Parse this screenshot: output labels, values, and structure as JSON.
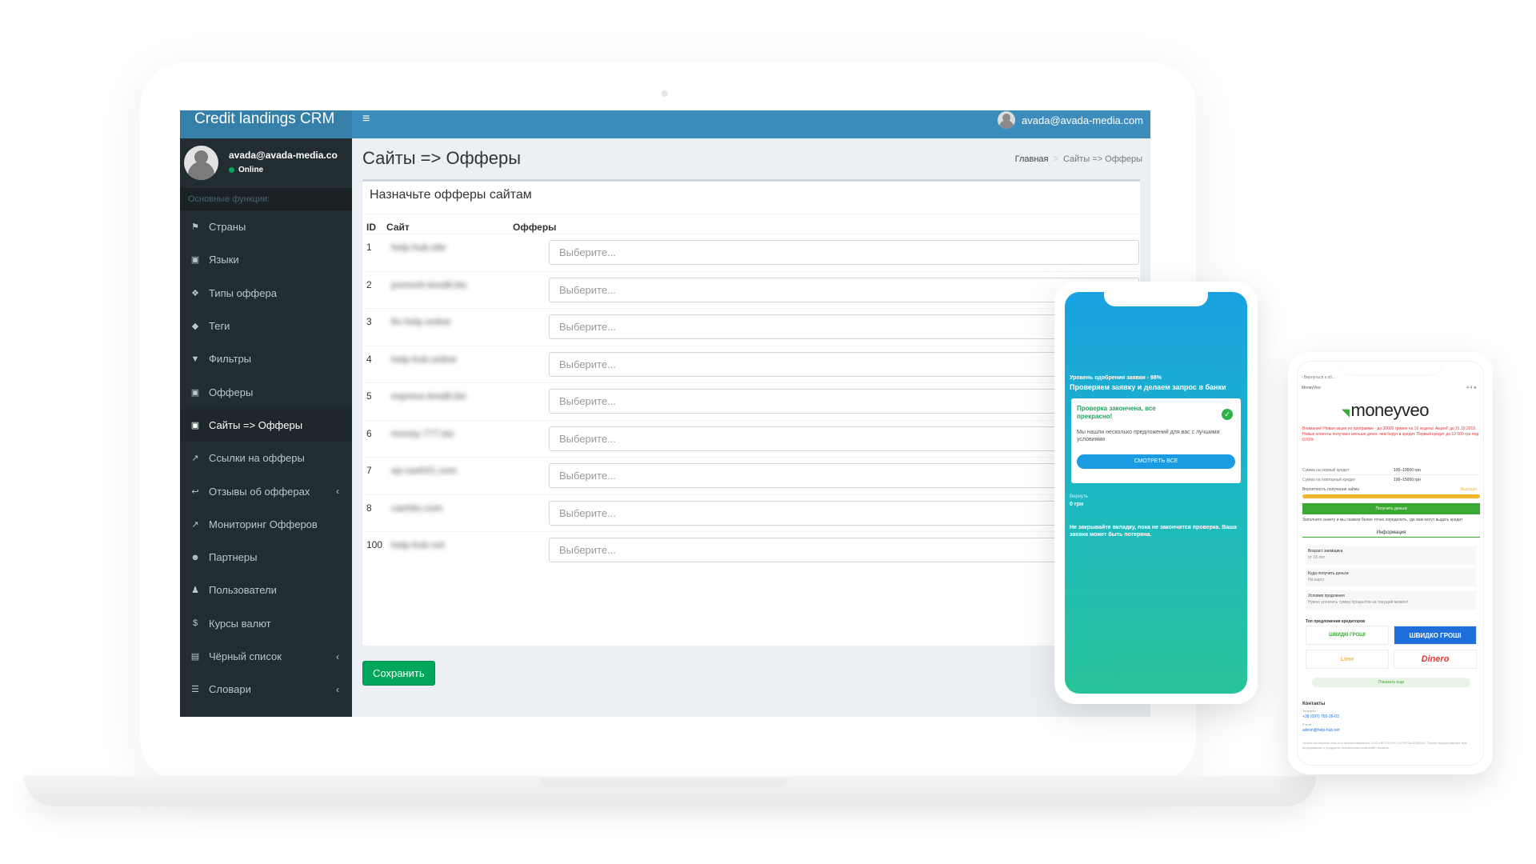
{
  "crm": {
    "brand": "Credit landings CRM",
    "menu_toggle_glyph": "≡",
    "top_user_email": "avada@avada-media.com",
    "sidebar_user_email": "avada@avada-media.co",
    "sidebar_user_status": "Online",
    "menu_header": "Основные функции:",
    "menu": [
      {
        "label": "Страны",
        "icon": "flag-icon",
        "glyph": "⚑"
      },
      {
        "label": "Языки",
        "icon": "language-icon",
        "glyph": "▣"
      },
      {
        "label": "Типы оффера",
        "icon": "dropbox-icon",
        "glyph": "❖"
      },
      {
        "label": "Теги",
        "icon": "tag-icon",
        "glyph": "◆"
      },
      {
        "label": "Фильтры",
        "icon": "filter-icon",
        "glyph": "▼"
      },
      {
        "label": "Офферы",
        "icon": "money-icon",
        "glyph": "▣"
      },
      {
        "label": "Сайты => Офферы",
        "icon": "money-icon",
        "glyph": "▣"
      },
      {
        "label": "Ссылки на офферы",
        "icon": "external-link-icon",
        "glyph": "↗"
      },
      {
        "label": "Отзывы об офферах",
        "icon": "reply-icon",
        "glyph": "↩",
        "arrow": "‹"
      },
      {
        "label": "Мониторинг Офферов",
        "icon": "external-link-icon",
        "glyph": "↗"
      },
      {
        "label": "Партнеры",
        "icon": "users-icon",
        "glyph": "☻"
      },
      {
        "label": "Пользователи",
        "icon": "user-icon",
        "glyph": "♟"
      },
      {
        "label": "Курсы валют",
        "icon": "dollar-icon",
        "glyph": "$"
      },
      {
        "label": "Чёрный список",
        "icon": "file-icon",
        "glyph": "▤",
        "arrow": "‹"
      },
      {
        "label": "Словари",
        "icon": "list-icon",
        "glyph": "☰",
        "arrow": "‹"
      }
    ],
    "active_index": 6,
    "page_title": "Сайты => Офферы",
    "breadcrumb": {
      "home": "Главная",
      "separator": ">",
      "current": "Сайты => Офферы"
    },
    "box_title": "Назначьте офферы сайтам",
    "columns": {
      "id": "ID",
      "site": "Сайт",
      "offers": "Офферы"
    },
    "rows": [
      {
        "id": "1",
        "site": "help-hub.site",
        "select_placeholder": "Выберите..."
      },
      {
        "id": "2",
        "site": "pomosh-kredit.biz",
        "select_placeholder": "Выберите..."
      },
      {
        "id": "3",
        "site": "fin-help.online",
        "select_placeholder": "Выберите..."
      },
      {
        "id": "4",
        "site": "help-hub.online",
        "select_placeholder": "Выберите..."
      },
      {
        "id": "5",
        "site": "express-kredit.biz",
        "select_placeholder": "Выберите..."
      },
      {
        "id": "6",
        "site": "money-777.biz",
        "select_placeholder": "Выберите..."
      },
      {
        "id": "7",
        "site": "ep-cash01.com",
        "select_placeholder": "Выберите..."
      },
      {
        "id": "8",
        "site": "cashito.com",
        "select_placeholder": "Выберите..."
      },
      {
        "id": "100",
        "site": "help-hub.net",
        "select_placeholder": "Выберите..."
      }
    ],
    "save_label": "Сохранить",
    "colors": {
      "header": "#3c8dbc",
      "brand_bg": "#367fa9",
      "sidebar": "#222d32",
      "save": "#00a65a"
    }
  },
  "phone1": {
    "approval": "Уровень одобрения заявки - 98%",
    "headline": "Проверяем заявку и делаем запрос в банки",
    "done": "Проверка закончена, все прекрасно!",
    "desc": "Мы нашли несколько предложений для вас с лучшими условиями",
    "button": "СМОТРЕТЬ ВСЕ",
    "sum_label": "Вернуть",
    "sum_value": "0 грн",
    "note": "Не закрывайте вкладку, пока не закончится проверка. Ваша заявка может быть потеряна."
  },
  "phone2": {
    "back": "‹ Вернуться к об...",
    "brand_small": "MoneyVeo",
    "rating": "4.4 ★",
    "logo": "moneyveo",
    "warning": "Внимание! Новая акция по программе - до 30000 гривен на 16 недель! Акция!! до 31.10.2019. Новые клиенты получают меньше денег, чем берут в кредит. Первый кредит до 10 000 грн под 0.01%",
    "kv": [
      {
        "k": "Сумма на первый кредит",
        "v": "100–10000 грн"
      },
      {
        "k": "Сумма на повторный кредит",
        "v": "100–15000 грн"
      }
    ],
    "probability_label": "Вероятность получения займа",
    "probability_value": "Высокая",
    "get_money": "Получить деньги",
    "hint": "Заполните анкету и мы скажем более точно определить, где вам могут выдать кредит",
    "info_title": "Информация",
    "info": [
      {
        "k": "Возраст заемщика",
        "v": "от 18 лет"
      },
      {
        "k": "Куда получить деньги",
        "v": "На карту"
      },
      {
        "k": "Условия продления",
        "v": "Нужно уплатить сумму процентов на текущий момент"
      }
    ],
    "top_title": "Топ предложения кредиторов",
    "lenders": [
      "ШВИДКО ГРОШІ",
      "Dinero",
      "ШВИДКІ ГРОШІ",
      "Lime"
    ],
    "show_all": "Показать еще",
    "contacts_title": "Контакты",
    "phone_label": "Телефон",
    "phone": "+38 (097) 755-26-03",
    "email_label": "E-mail",
    "email": "admin@help-hub.net",
    "footer": "Услуги на портале help-hub предоставляются ООО НЕОТЕХНО-ХУПРОА-ВОДКАН. Проект предоставляет всю информацию о продуктах финансовых компаний Украины."
  }
}
